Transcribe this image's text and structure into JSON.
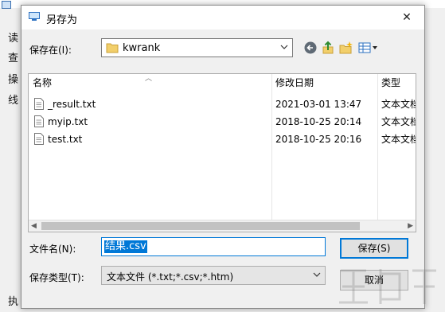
{
  "background_window": {
    "labels": [
      "读",
      "查",
      "操",
      "线"
    ],
    "bottom_label": "执"
  },
  "dialog": {
    "title": "另存为",
    "close_symbol": "✕",
    "save_in_label": "保存在(I):",
    "location": "kwrank",
    "toolbar": {
      "back": "back-icon",
      "up": "up-folder-icon",
      "new_folder": "new-folder-icon",
      "view": "view-menu-icon"
    },
    "file_list": {
      "columns": [
        "名称",
        "修改日期",
        "类型"
      ],
      "rows": [
        {
          "name": "_result.txt",
          "date": "2021-03-01 13:47",
          "type": "文本文档"
        },
        {
          "name": "myip.txt",
          "date": "2018-10-25 20:14",
          "type": "文本文档"
        },
        {
          "name": "test.txt",
          "date": "2018-10-25 20:16",
          "type": "文本文档"
        }
      ]
    },
    "filename_label": "文件名(N):",
    "filename_value": "结果.csv",
    "filetype_label": "保存类型(T):",
    "filetype_value": "文本文件 (*.txt;*.csv;*.htm)",
    "save_button": "保存(S)",
    "cancel_button": "取消"
  },
  "colors": {
    "accent": "#0078d7",
    "dialog_bg": "#f0f0f0",
    "folder": "#e8c15a"
  }
}
